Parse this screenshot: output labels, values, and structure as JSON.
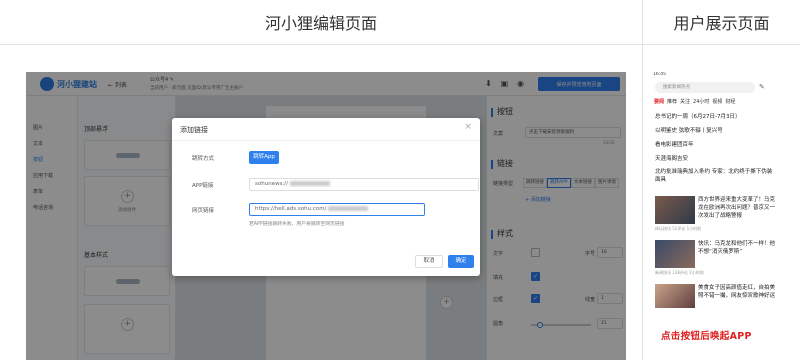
{
  "headers": {
    "editor": "河小狸编辑页面",
    "user": "用户展示页面"
  },
  "editor": {
    "logo": "河小狸建站",
    "back": "← 列表",
    "page_info_1": "公众号4 ✎",
    "page_info_2": "当前用户 · 新页面 页面ID:默认专用广告主账户",
    "primary_button": "保存并预览落地页面",
    "left_nav": [
      "图片",
      "文本",
      "按钮",
      "应用下载",
      "表单",
      "电话咨询"
    ],
    "section_1": "顶部悬浮",
    "section_2": "基本样式",
    "add_text": "添加组件",
    "right_panel": {
      "section_button": "按钮",
      "label_copy": "文案",
      "copy_value": "点击下载安装领取福利",
      "counter": "10/20",
      "section_link": "链接",
      "label_link_type": "链接类型",
      "link_types": [
        "跳转链接",
        "跳转APP",
        "文本链接",
        "图片弹窗"
      ],
      "add_link": "+ 添加链接",
      "section_style": "样式",
      "label_text": "文字",
      "font_size_label": "字号",
      "font_size_value": "16",
      "label_fill": "填充",
      "label_border": "边框",
      "label_radius": "圆角",
      "border_label": "线宽",
      "border_value": "1",
      "radius_value": "21"
    }
  },
  "modal": {
    "title": "添加链接",
    "close": "×",
    "label_jump": "跳转方式",
    "jump_value": "跳转App",
    "label_app_link": "APP链接",
    "app_link_value": "sohunews://",
    "label_web_link": "网页链接",
    "web_link_value": "https://hell.ads.sohu.com/",
    "hint": "若APP链接跳转失败，用户将跳转至网页链接",
    "cancel": "取消",
    "ok": "确定"
  },
  "preview": {
    "status": "16:45",
    "search_placeholder": "搜索新闻热点",
    "tabs": [
      "要闻",
      "推荐",
      "关注",
      "24小时",
      "视频",
      "财经"
    ],
    "headlines": [
      "总书记的一周（6月27日-7月3日）",
      "以明鉴史 弦歌不辍丨复兴号",
      "看电影建团百年",
      "天涯海阁吉安",
      "北约批准瑞典加入条约 专家：北约终于撕下伪装面具"
    ],
    "news": [
      {
        "title": "西方世界迎来重大变革了！马克龙在欧洲再次出问题？普京又一次发出了战略警报",
        "meta": "体坛快讯 52评论 1小时前"
      },
      {
        "title": "快讯：马克龙和他们不一样！他不想“消灭俄罗斯”",
        "meta": "新闻快讯 128评论 2小时前"
      },
      {
        "title": "美食女子因高颜值走红，自拍美照不错一撮，网友惊叹歌神好运",
        "meta": "生活资讯 36评论"
      }
    ],
    "cta": "点击按钮后唤起APP"
  }
}
